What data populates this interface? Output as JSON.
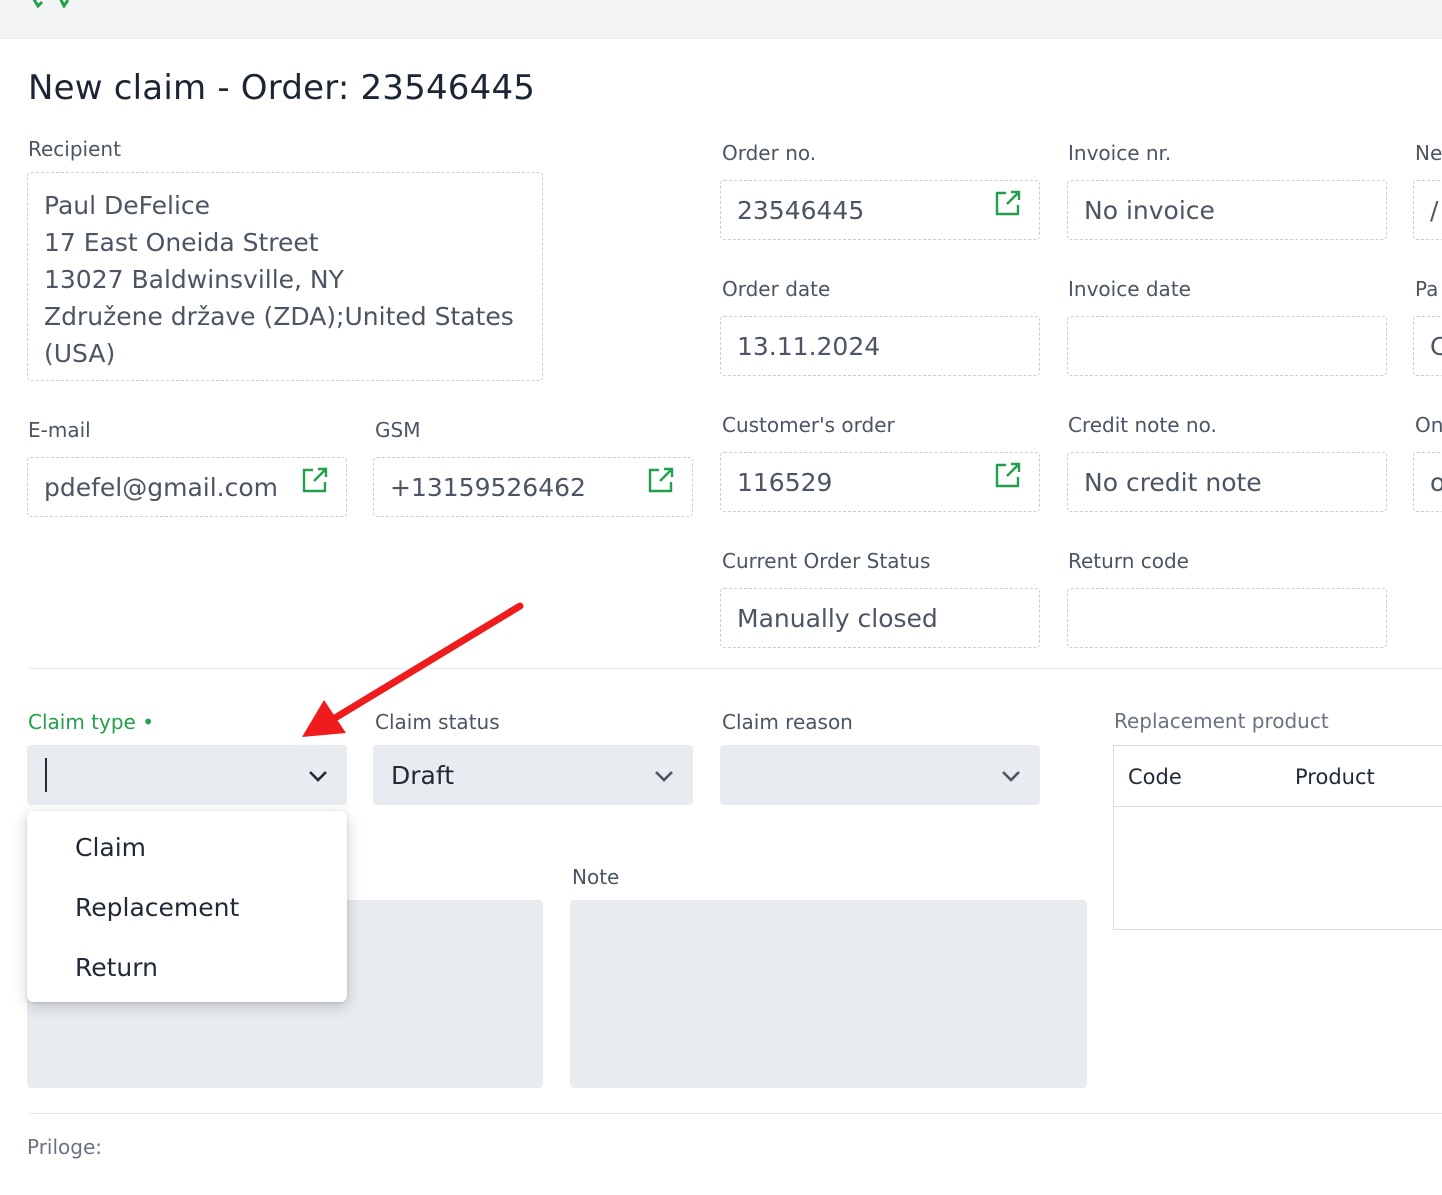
{
  "page": {
    "title": "New claim - Order: 23546445"
  },
  "colors": {
    "accent": "#22a04b",
    "annotation_arrow": "#ee1c1c",
    "field_fill": "#e8ebef"
  },
  "icons": {
    "external_link": "external-link-icon",
    "chevron": "chevron-down-icon",
    "logo": "logo-icon"
  },
  "recipient": {
    "label": "Recipient",
    "lines": [
      "Paul DeFelice",
      "17 East Oneida Street",
      "13027 Baldwinsville, NY",
      "Združene države (ZDA);United States",
      "(USA)"
    ]
  },
  "email": {
    "label": "E-mail",
    "value": "pdefel@gmail.com"
  },
  "gsm": {
    "label": "GSM",
    "value": "+13159526462"
  },
  "order": {
    "no_label": "Order no.",
    "no_value": "23546445",
    "date_label": "Order date",
    "date_value": "13.11.2024",
    "customer_label": "Customer's order",
    "customer_value": "116529",
    "status_label": "Current Order Status",
    "status_value": "Manually closed"
  },
  "invoice": {
    "nr_label": "Invoice nr.",
    "nr_value": "No invoice",
    "date_label": "Invoice date",
    "date_value": "",
    "credit_label": "Credit note no.",
    "credit_value": "No credit note",
    "return_label": "Return code",
    "return_value": ""
  },
  "col3": {
    "label1": "Ne",
    "value1": "/",
    "label2": "Pa",
    "value2": "C",
    "label3": "On",
    "value3": "o"
  },
  "claim": {
    "type_label": "Claim type",
    "required_marker": "•",
    "status_label": "Claim status",
    "status_value": "Draft",
    "reason_label": "Claim reason",
    "reason_value": ""
  },
  "dropdown": {
    "options": [
      "Claim",
      "Replacement",
      "Return"
    ]
  },
  "replacement": {
    "label": "Replacement product",
    "col_code": "Code",
    "col_product": "Product"
  },
  "note": {
    "label": "Note"
  },
  "attachments": {
    "label": "Priloge:"
  }
}
